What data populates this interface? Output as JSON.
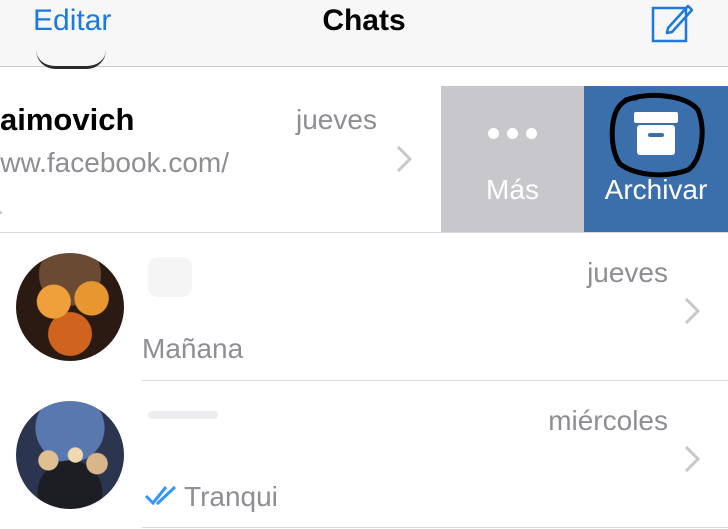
{
  "navbar": {
    "edit_label": "Editar",
    "title": "Chats",
    "compose_icon": "compose-icon"
  },
  "swiped_chat": {
    "name": "aimovich",
    "date": "jueves",
    "message_line1": "www.facebook.com/",
    "message_line2": "t.",
    "actions": {
      "more_label": "Más",
      "more_icon": "ellipsis-icon",
      "archive_label": "Archivar",
      "archive_icon": "archive-box-icon"
    }
  },
  "chats": [
    {
      "name": "",
      "date": "jueves",
      "message": "Mañana",
      "read_receipt": false
    },
    {
      "name": "",
      "date": "miércoles",
      "message": "Tranqui",
      "read_receipt": true
    }
  ],
  "colors": {
    "accent": "#1a7ae0",
    "archive_bg": "#3b6fac",
    "more_bg": "#c7c7cc",
    "secondary_text": "#8e8e93",
    "annotation_circle": "#000000"
  }
}
